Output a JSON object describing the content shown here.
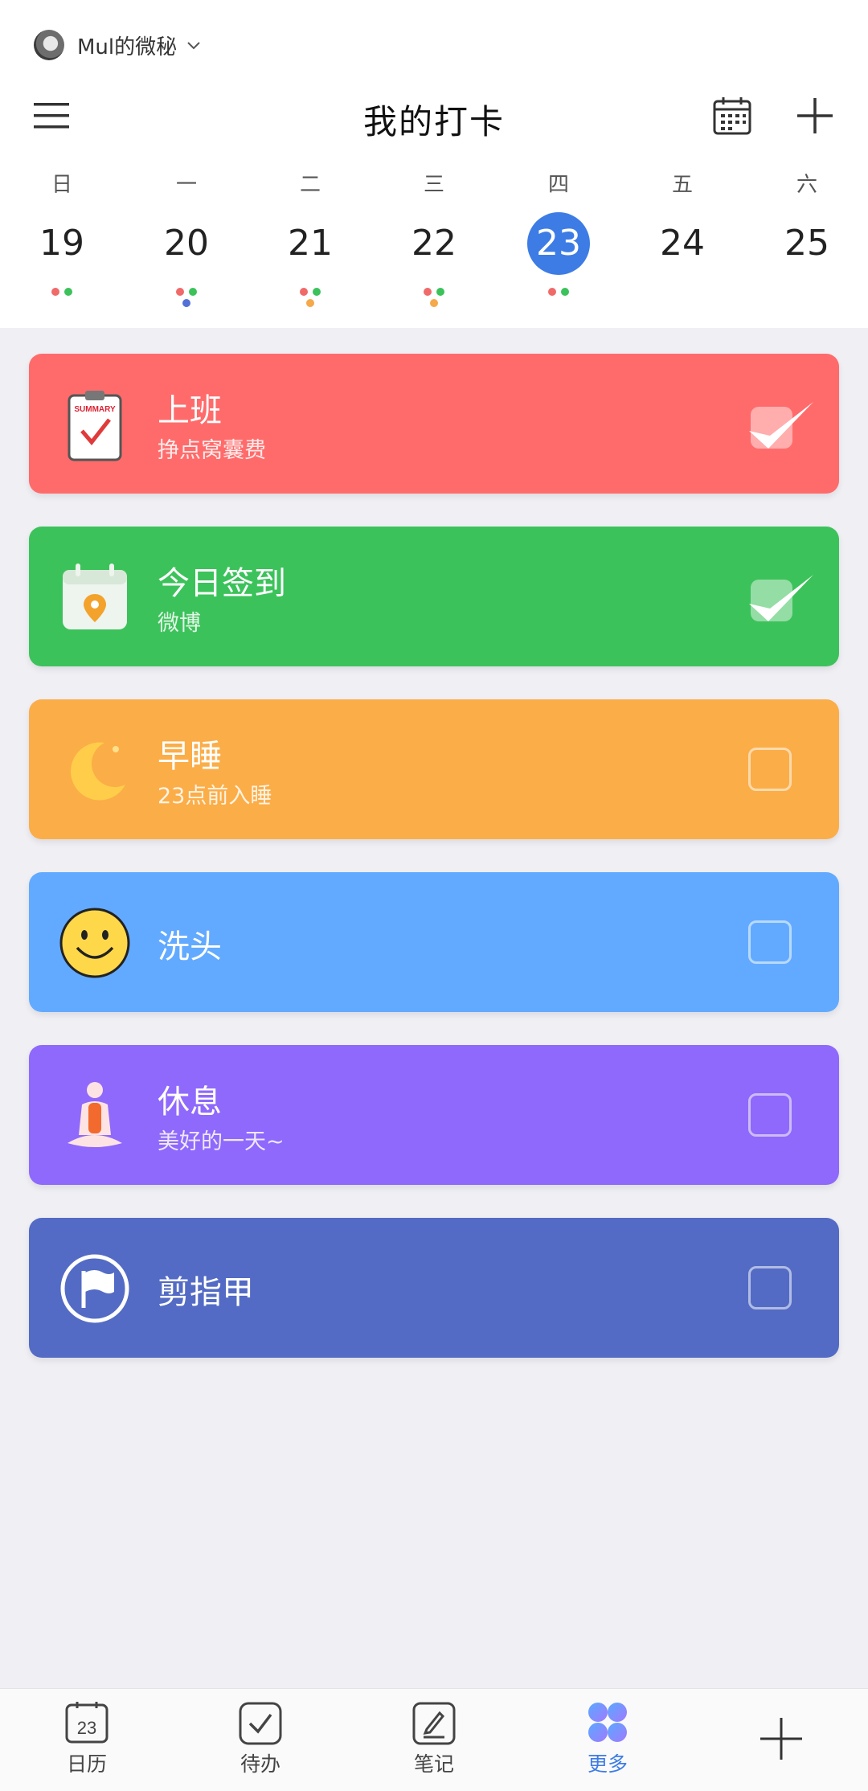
{
  "header": {
    "account_name": "Mul的微秘",
    "title": "我的打卡"
  },
  "week": [
    {
      "dow": "日",
      "date": "19",
      "selected": false,
      "dots": [
        "#f06a6a",
        "#3cc25b"
      ]
    },
    {
      "dow": "一",
      "date": "20",
      "selected": false,
      "dots": [
        "#f06a6a",
        "#3cc25b",
        "#5470d6"
      ]
    },
    {
      "dow": "二",
      "date": "21",
      "selected": false,
      "dots": [
        "#f06a6a",
        "#3cc25b",
        "#f5a94a"
      ]
    },
    {
      "dow": "三",
      "date": "22",
      "selected": false,
      "dots": [
        "#f06a6a",
        "#3cc25b",
        "#f5a94a"
      ]
    },
    {
      "dow": "四",
      "date": "23",
      "selected": true,
      "dots": [
        "#f06a6a",
        "#3cc25b"
      ]
    },
    {
      "dow": "五",
      "date": "24",
      "selected": false,
      "dots": []
    },
    {
      "dow": "六",
      "date": "25",
      "selected": false,
      "dots": []
    }
  ],
  "habits": [
    {
      "name": "上班",
      "subtitle": "挣点窝囊费",
      "color": "#ff6b6b",
      "icon": "clipboard-summary-icon",
      "icon_text": "SUMMARY",
      "checked": true
    },
    {
      "name": "今日签到",
      "subtitle": "微博",
      "color": "#3cc25b",
      "icon": "calendar-location-icon",
      "checked": true
    },
    {
      "name": "早睡",
      "subtitle": "23点前入睡",
      "color": "#fbad48",
      "icon": "moon-icon",
      "checked": false
    },
    {
      "name": "洗头",
      "subtitle": "",
      "color": "#62aaff",
      "icon": "smiley-icon",
      "checked": false
    },
    {
      "name": "休息",
      "subtitle": "美好的一天~",
      "color": "#8f69fb",
      "icon": "meditation-icon",
      "checked": false
    },
    {
      "name": "剪指甲",
      "subtitle": "",
      "color": "#536bc4",
      "icon": "flag-icon",
      "checked": false
    }
  ],
  "nav": {
    "calendar_label": "日历",
    "calendar_date": "23",
    "todo_label": "待办",
    "notes_label": "笔记",
    "more_label": "更多"
  },
  "colors": {
    "accent": "#3d7ce5",
    "background": "#efeff4"
  }
}
